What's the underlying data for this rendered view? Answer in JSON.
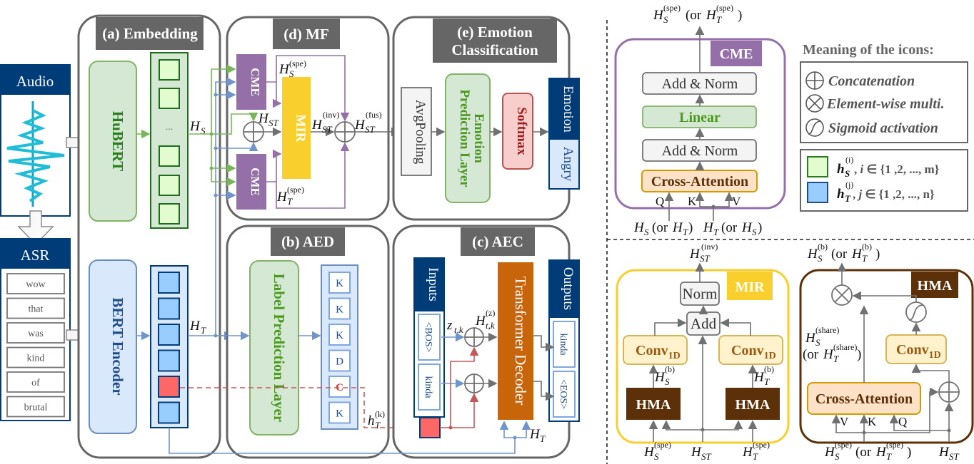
{
  "figure": {
    "inputs": {
      "audio_label": "Audio",
      "asr_label": "ASR",
      "asr_words": [
        "wow",
        "that",
        "was",
        "kind",
        "of",
        "brutal"
      ]
    },
    "embedding": {
      "title": "(a) Embedding",
      "hubert_label": "HuBERT",
      "bert_label": "BERT Encoder",
      "speech_seq_ellipsis": "...",
      "hs_label": "H",
      "hs_sub": "S",
      "ht_label": "H",
      "ht_sub": "T"
    },
    "mf": {
      "title": "(d) MF",
      "cme_label": "CME",
      "mir_label": "MIR",
      "hst_label": "H",
      "hst_sub": "ST",
      "hs_spe_sup": "(spe)",
      "hs_spe_sub": "S",
      "ht_spe_sup": "(spe)",
      "ht_spe_sub": "T",
      "inv_sup": "(inv)",
      "fus_sup": "(fus)"
    },
    "emotion": {
      "title_line1": "(e) Emotion",
      "title_line2": "Classification",
      "avgpool_label": "AvgPooling",
      "pred_line1": "Emotion",
      "pred_line2": "Prediction Layer",
      "softmax_label": "Softmax",
      "emotion_header": "Emotion",
      "emotion_value": "Angry"
    },
    "aed": {
      "title": "(b) AED",
      "label_pred": "Label Prediction Layer",
      "labels": [
        "K",
        "K",
        "K",
        "D",
        "C",
        "K"
      ],
      "highlight_index": 4,
      "hk_label": "h",
      "hk_sup": "(k)",
      "hk_sub": "T"
    },
    "aec": {
      "title": "(c) AEC",
      "inputs_header": "Inputs",
      "inputs": [
        "<BOS>",
        "kinda"
      ],
      "outputs_header": "Outputs",
      "outputs": [
        "kinda",
        "<EOS>"
      ],
      "decoder_label": "Transformer Decoder",
      "z_label": "z",
      "z_sub": "t,k",
      "hz_label": "H",
      "hz_sup": "(z)",
      "hz_sub": "t,k",
      "ht_label": "H",
      "ht_sub": "T"
    },
    "cme_detail": {
      "badge": "CME",
      "top_output": "H_S^(spe) (or H_T^(spe))",
      "add_norm": "Add & Norm",
      "linear": "Linear",
      "cross_attention": "Cross-Attention",
      "q": "Q",
      "k": "K",
      "v": "V",
      "input_left": "H_S (or H_T)",
      "input_right": "H_T (or H_S)"
    },
    "legend": {
      "title": "Meaning of the icons:",
      "items": [
        {
          "icon": "concat-icon",
          "label": "Concatenation"
        },
        {
          "icon": "multiply-icon",
          "label": "Element-wise multi."
        },
        {
          "icon": "sigmoid-icon",
          "label": "Sigmoid activation"
        }
      ],
      "tokens": [
        {
          "color": "#e2fbcf",
          "border": "#2a7d1e",
          "label": "h_S^(i), i ∈ {1 ,2, ..., m}"
        },
        {
          "color": "#99ccff",
          "border": "#1f4e86",
          "label": "h_T^(j), j ∈ {1 ,2, ..., n}"
        }
      ]
    },
    "mir_detail": {
      "badge": "MIR",
      "top_output": "H_ST^(inv)",
      "norm": "Norm",
      "add": "Add",
      "conv": "Conv",
      "conv_sub": "1D",
      "hma": "HMA",
      "hs_b": "H_S^(b)",
      "ht_b": "H_T^(b)",
      "input_left": "H_S^(spe)",
      "input_mid": "H_ST",
      "input_right": "H_T^(spe)"
    },
    "hma_detail": {
      "badge": "HMA",
      "top_output": "H_S^(b) (or H_T^(b))",
      "share_line1": "H_S^(share)",
      "share_line2": "(or H_T^(share))",
      "conv": "Conv",
      "conv_sub": "1D",
      "cross_attention": "Cross-Attention",
      "v": "V",
      "k": "K",
      "q": "Q",
      "input_left": "H_S^(spe)(or H_T^(spe))",
      "input_right": "H_ST"
    },
    "colors": {
      "panel_border": "#666666",
      "header_bg": "#666666",
      "navy": "#003c78",
      "green_text": "#2a7d1e",
      "purple": "#9570a8",
      "mir_yellow": "#f8cf2c",
      "decoder_orange": "#c8640a",
      "hma_brown": "#5c3008",
      "softmax_red": "#a51c1c"
    }
  }
}
